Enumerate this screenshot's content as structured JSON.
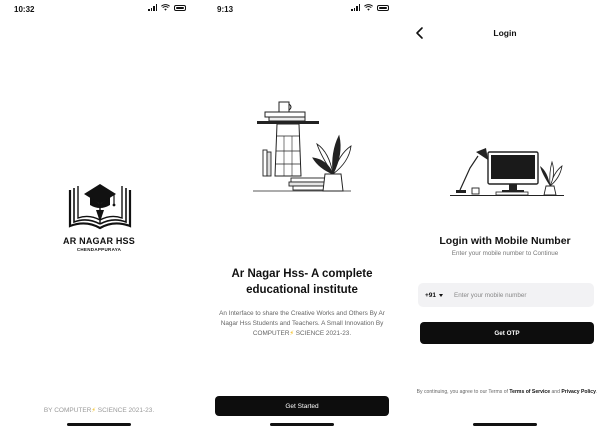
{
  "screens": {
    "splash": {
      "status_time": "10:32",
      "school_name": "AR NAGAR HSS",
      "school_location": "CHENDAPPURAYA",
      "footer_prefix": "BY COMPUTER",
      "footer_bolt": "⚡",
      "footer_suffix": " SCIENCE 2021-23."
    },
    "onboarding": {
      "status_time": "9:13",
      "title": "Ar Nagar Hss- A complete educational institute",
      "description_prefix": "An Interface to share the Creative Works and Others By Ar Nagar Hss Students and Teachers.  A Small Innovation By COMPUTER",
      "description_bolt": "⚡",
      "description_suffix": " SCIENCE 2021-23.",
      "button_label": "Get Started"
    },
    "login": {
      "nav_title": "Login",
      "heading": "Login with Mobile Number",
      "subheading": "Enter your mobile number to Continue",
      "country_code": "+91",
      "phone_placeholder": "Enter your mobile number",
      "button_label": "Get OTP",
      "terms_prefix": "By continuing, you agree to our Terms of ",
      "terms_service": "Terms of Service",
      "terms_and": " and ",
      "terms_privacy": "Privacy Policy",
      "terms_end": "."
    }
  },
  "icons": {
    "status": [
      "signal-icon",
      "wifi-icon",
      "battery-icon"
    ],
    "back": "chevron-left-icon",
    "country_dropdown": "caret-down-icon"
  },
  "colors": {
    "primary_button": "#0d0d0d",
    "input_background": "#f2f2f4",
    "accent_bolt": "#f2b705"
  }
}
